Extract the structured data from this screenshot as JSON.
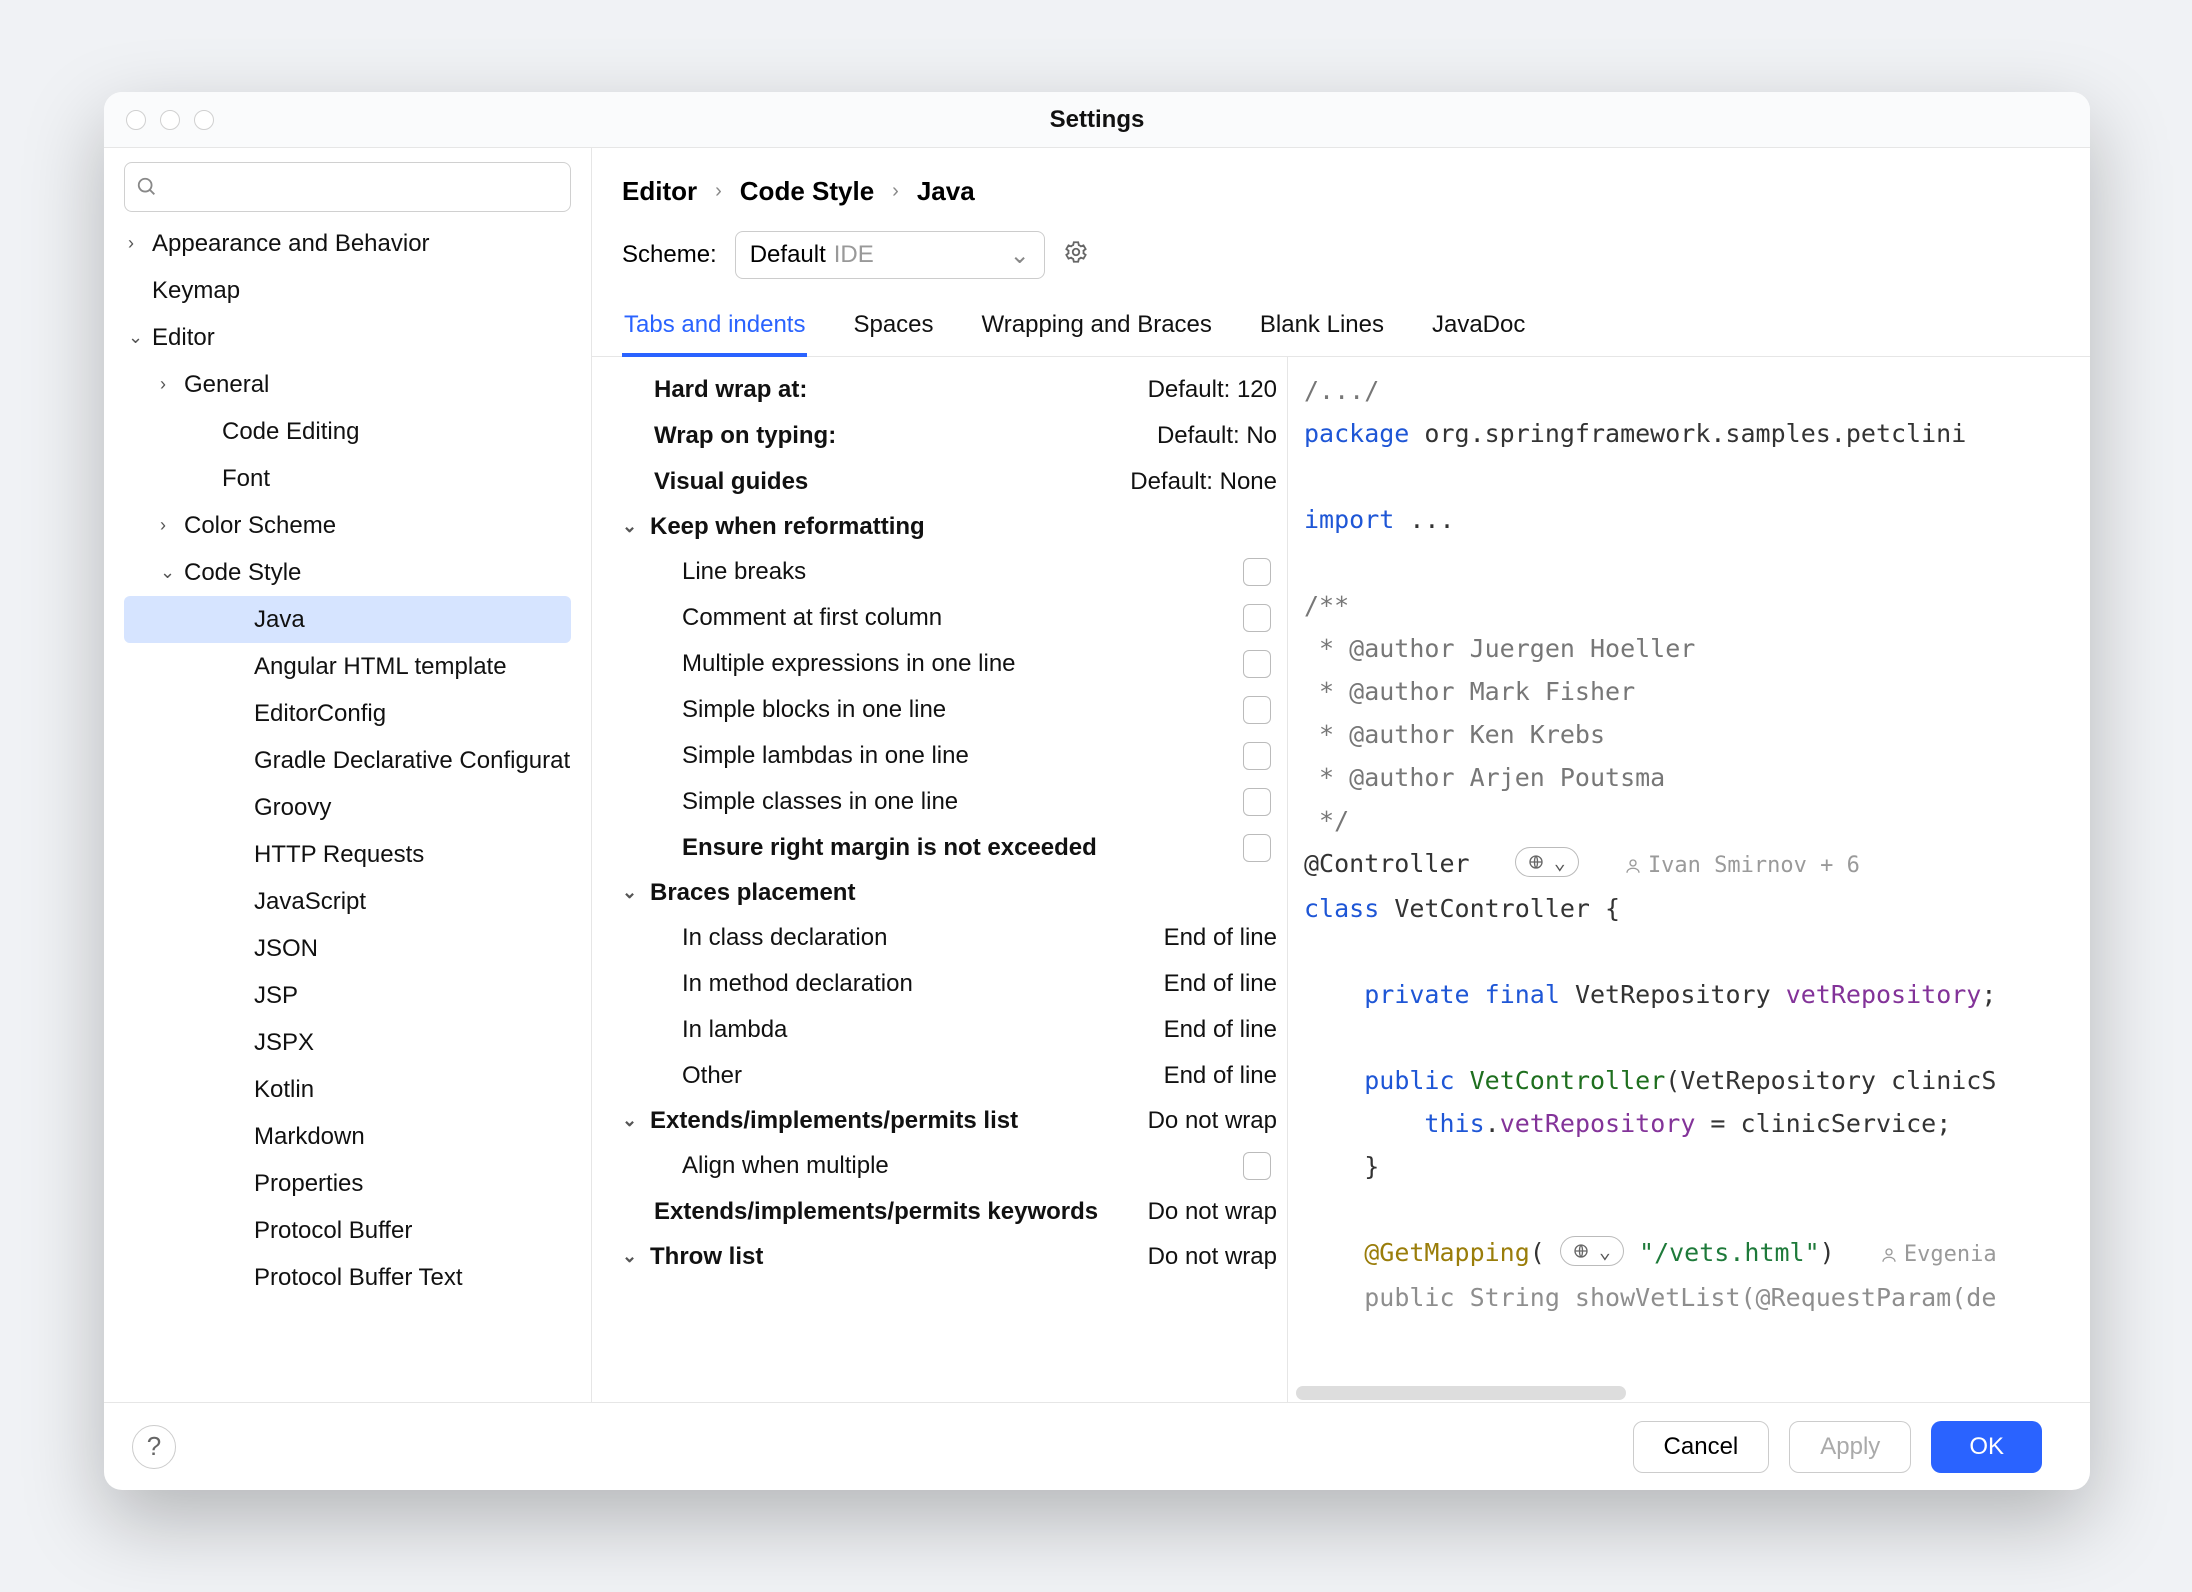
{
  "window": {
    "title": "Settings"
  },
  "search": {
    "placeholder": ""
  },
  "sidebar": [
    {
      "label": "Appearance and Behavior",
      "arrow": "›",
      "indent": 0
    },
    {
      "label": "Keymap",
      "arrow": "",
      "indent": 0
    },
    {
      "label": "Editor",
      "arrow": "⌄",
      "indent": 0
    },
    {
      "label": "General",
      "arrow": "›",
      "indent": 1
    },
    {
      "label": "Code Editing",
      "arrow": "",
      "indent": 2
    },
    {
      "label": "Font",
      "arrow": "",
      "indent": 2
    },
    {
      "label": "Color Scheme",
      "arrow": "›",
      "indent": 1
    },
    {
      "label": "Code Style",
      "arrow": "⌄",
      "indent": 1
    },
    {
      "label": "Java",
      "arrow": "",
      "indent": 3,
      "selected": true
    },
    {
      "label": "Angular HTML template",
      "arrow": "",
      "indent": 3
    },
    {
      "label": "EditorConfig",
      "arrow": "",
      "indent": 3
    },
    {
      "label": "Gradle Declarative Configurat",
      "arrow": "",
      "indent": 3
    },
    {
      "label": "Groovy",
      "arrow": "",
      "indent": 3
    },
    {
      "label": "HTTP Requests",
      "arrow": "",
      "indent": 3
    },
    {
      "label": "JavaScript",
      "arrow": "",
      "indent": 3
    },
    {
      "label": "JSON",
      "arrow": "",
      "indent": 3
    },
    {
      "label": "JSP",
      "arrow": "",
      "indent": 3
    },
    {
      "label": "JSPX",
      "arrow": "",
      "indent": 3
    },
    {
      "label": "Kotlin",
      "arrow": "",
      "indent": 3
    },
    {
      "label": "Markdown",
      "arrow": "",
      "indent": 3
    },
    {
      "label": "Properties",
      "arrow": "",
      "indent": 3
    },
    {
      "label": "Protocol Buffer",
      "arrow": "",
      "indent": 3
    },
    {
      "label": "Protocol Buffer Text",
      "arrow": "",
      "indent": 3
    }
  ],
  "breadcrumbs": [
    "Editor",
    "Code Style",
    "Java"
  ],
  "scheme": {
    "label": "Scheme:",
    "name": "Default",
    "scope": "IDE"
  },
  "tabs": [
    "Tabs and indents",
    "Spaces",
    "Wrapping and Braces",
    "Blank Lines",
    "JavaDoc"
  ],
  "activeTab": 0,
  "form": {
    "topValues": [
      {
        "label": "Hard wrap at:",
        "value": "Default: 120"
      },
      {
        "label": "Wrap on typing:",
        "value": "Default: No"
      },
      {
        "label": "Visual guides",
        "value": "Default: None"
      }
    ],
    "keepHdr": "Keep when reformatting",
    "keepItems": [
      "Line breaks",
      "Comment at first column",
      "Multiple expressions in one line",
      "Simple blocks in one line",
      "Simple lambdas in one line",
      "Simple classes in one line"
    ],
    "ensure": "Ensure right margin is not exceeded",
    "bracesHdr": "Braces placement",
    "braces": [
      {
        "label": "In class declaration",
        "value": "End of line"
      },
      {
        "label": "In method declaration",
        "value": "End of line"
      },
      {
        "label": "In lambda",
        "value": "End of line"
      },
      {
        "label": "Other",
        "value": "End of line"
      }
    ],
    "extHdr": "Extends/implements/permits list",
    "extHdrVal": "Do not wrap",
    "align": "Align when multiple",
    "extKw": "Extends/implements/permits keywords",
    "extKwVal": "Do not wrap",
    "throwHdr": "Throw list",
    "throwVal": "Do not wrap"
  },
  "preview": {
    "l1a": "/.../",
    "l2a": "package",
    "l2b": " org.springframework.samples.petclini",
    "l3a": "import",
    "l3b": " ...",
    "j1": "/**",
    "j2": " * @author Juergen Hoeller",
    "j3": " * @author Mark Fisher",
    "j4": " * @author Ken Krebs",
    "j5": " * @author Arjen Poutsma",
    "j6": " */",
    "ctrl": "@Controller",
    "inlay1": "Ivan Smirnov + 6",
    "cls1": "class",
    "cls2": " VetController {",
    "f1": "private",
    "f2": "final",
    "f3": " VetRepository ",
    "f4": "vetRepository",
    "f5": ";",
    "c1": "public",
    "c2": "VetController",
    "c3": "(VetRepository clinicS",
    "t1": "this",
    "t2": ".",
    "t3": "vetRepository",
    "t4": " = clinicService;",
    "rb": "}",
    "gm1": "@GetMapping",
    "gm2": "(",
    "gm3": "\"/vets.html\"",
    "gm4": ")",
    "inlay2": "Evgenia",
    "last": "public String showVetList(@RequestParam(de"
  },
  "footer": {
    "cancel": "Cancel",
    "apply": "Apply",
    "ok": "OK"
  }
}
